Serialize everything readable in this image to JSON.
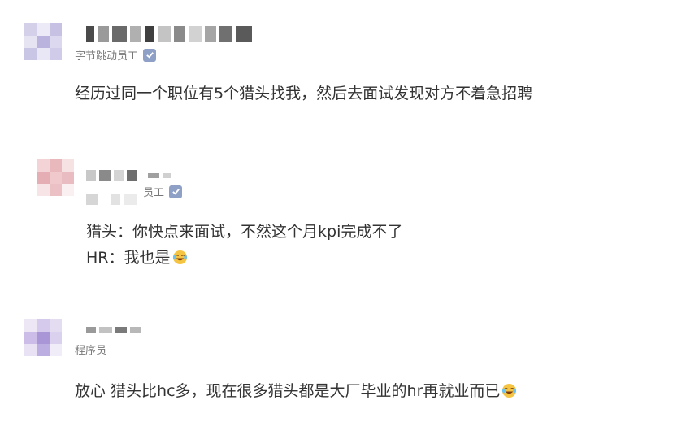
{
  "comments": [
    {
      "author_title": "字节跳动员工",
      "verified_icon": "verified-badge-icon",
      "text": "经历过同一个职位有5个猎头找我，然后去面试发现对方不着急招聘"
    },
    {
      "author_title": "员工",
      "verified_icon": "verified-badge-icon",
      "lines": [
        "猎头：你快点来面试，不然这个月kpi完成不了",
        "HR：我也是"
      ],
      "emoji_icon": "laughing-crying-emoji-icon"
    },
    {
      "author_title": "程序员",
      "text": "放心 猎头比hc多，现在很多猎头都是大厂毕业的hr再就业而已",
      "emoji_icon": "laughing-crying-emoji-icon"
    }
  ],
  "colors": {
    "text": "#333333",
    "meta": "#777777",
    "verified_badge": "#8fa0c7"
  }
}
